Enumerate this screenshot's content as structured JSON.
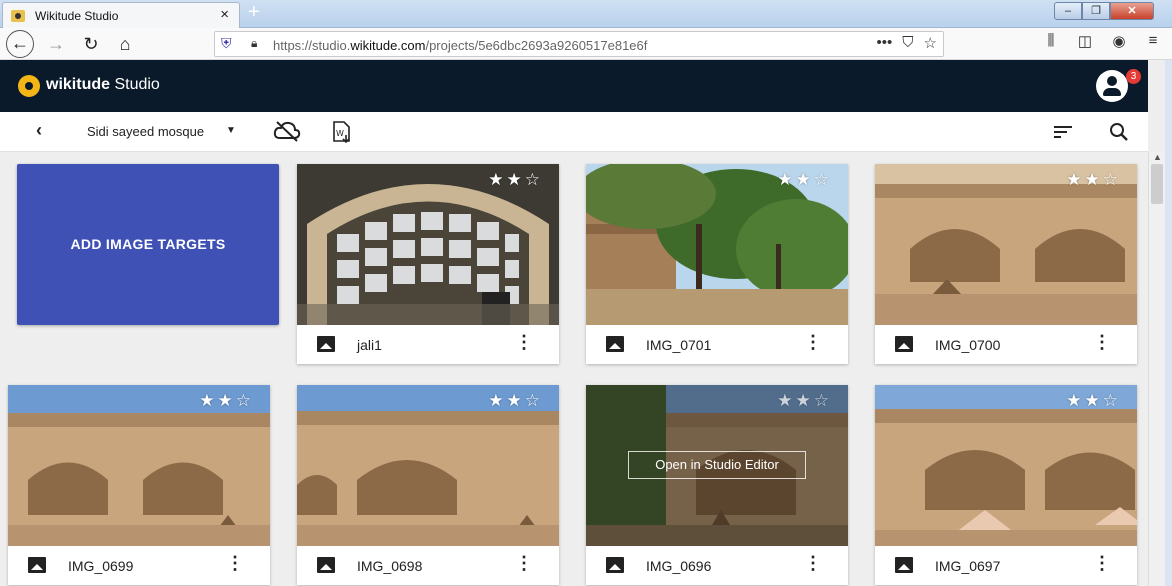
{
  "browser": {
    "tab_title": "Wikitude Studio",
    "tab_close": "×",
    "new_tab": "+",
    "url_prefix": "https://studio.",
    "url_domain": "wikitude.com",
    "url_path": "/projects/5e6dbc2693a9260517e81e6f",
    "url_more": "•••"
  },
  "app": {
    "logo_bold": "wikitude",
    "logo_rest": " Studio",
    "notification_count": "3"
  },
  "toolbar": {
    "project_name": "Sidi sayeed mosque"
  },
  "add_targets_label": "ADD IMAGE TARGETS",
  "open_editor_label": "Open in Studio Editor",
  "targets": [
    {
      "name": "jali1",
      "rating": 2,
      "max_rating": 3
    },
    {
      "name": "IMG_0701",
      "rating": 2,
      "max_rating": 3
    },
    {
      "name": "IMG_0700",
      "rating": 2,
      "max_rating": 3
    },
    {
      "name": "IMG_0699",
      "rating": 2,
      "max_rating": 3
    },
    {
      "name": "IMG_0698",
      "rating": 2,
      "max_rating": 3
    },
    {
      "name": "IMG_0696",
      "rating": 2,
      "max_rating": 3
    },
    {
      "name": "IMG_0697",
      "rating": 2,
      "max_rating": 3
    }
  ],
  "star_glyphs": {
    "filled": "★",
    "empty": "☆"
  },
  "menu_glyph": "⋮"
}
